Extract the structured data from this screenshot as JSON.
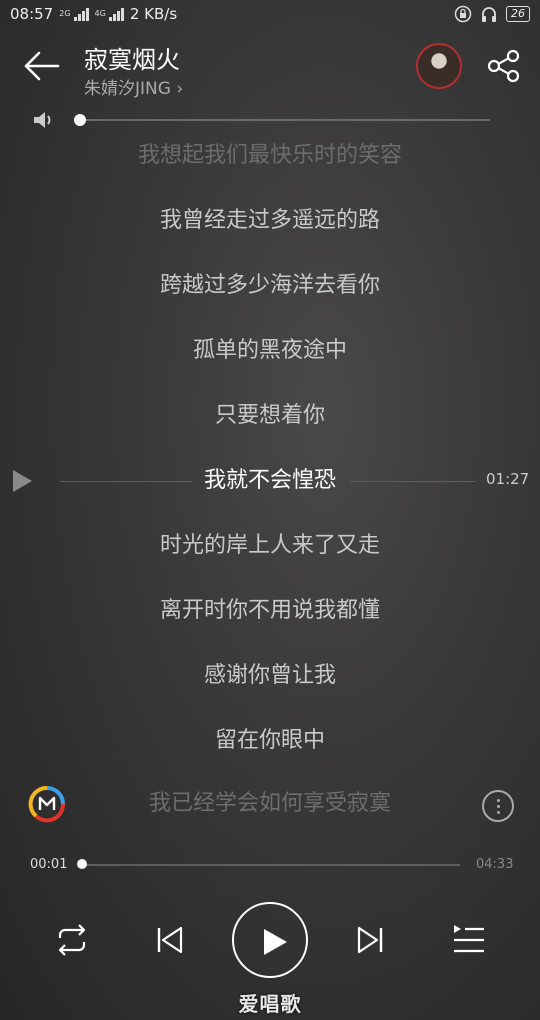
{
  "status_bar": {
    "time": "08:57",
    "net_2g": "2G",
    "net_4g": "4G",
    "speed": "2 KB/s",
    "battery": "26"
  },
  "header": {
    "song_title": "寂寞烟火",
    "artist": "朱婧汐JING",
    "artist_chevron": "›"
  },
  "volume": {
    "level": 0.0
  },
  "lyrics": {
    "lines": [
      "我想起我们最快乐时的笑容",
      "我曾经走过多遥远的路",
      "跨越过多少海洋去看你",
      "孤单的黑夜途中",
      "只要想着你",
      "我就不会惶恐",
      "时光的岸上人来了又走",
      "离开时你不用说我都懂",
      "感谢你曾让我",
      "留在你眼中",
      "我已经学会如何享受寂寞"
    ],
    "current_index": 5,
    "seek_time": "01:27"
  },
  "playback": {
    "current_time": "00:01",
    "total_time": "04:33",
    "progress": 0.004
  },
  "icons": {
    "back": "arrow-left-icon",
    "share": "share-icon",
    "volume": "speaker-icon",
    "repeat": "repeat-icon",
    "previous": "skip-previous-icon",
    "play": "play-icon",
    "next": "skip-next-icon",
    "playlist": "playlist-icon"
  },
  "watermark": "爱唱歌",
  "colors": {
    "background": "#3a3939",
    "accent_red": "#e2332b",
    "accent_blue": "#3aa0e8",
    "accent_yellow": "#f3b61f"
  }
}
